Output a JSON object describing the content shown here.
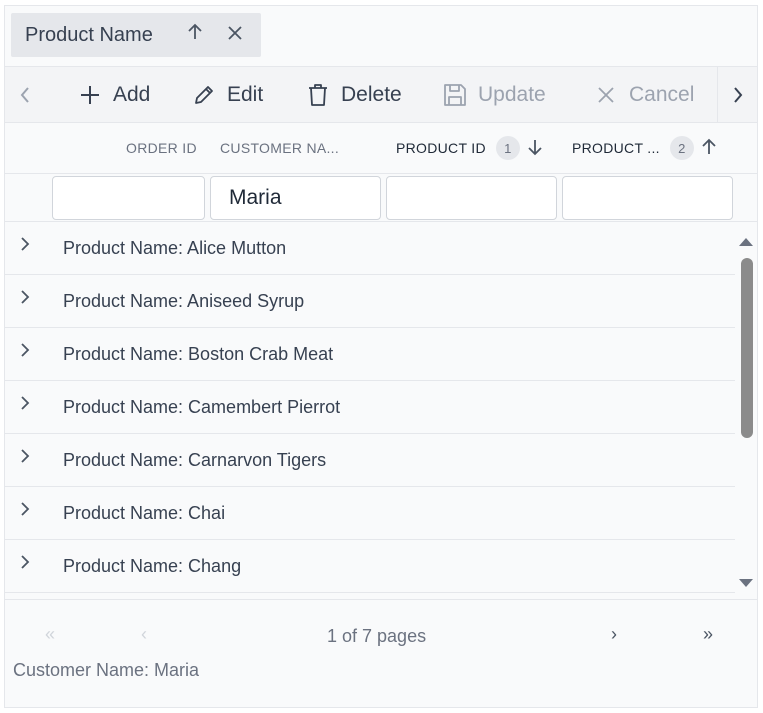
{
  "grouping": {
    "chip_label": "Product Name"
  },
  "toolbar": {
    "add": "Add",
    "edit": "Edit",
    "delete": "Delete",
    "update": "Update",
    "cancel": "Cancel"
  },
  "columns": {
    "order_id": "ORDER ID",
    "customer_name": "CUSTOMER NA...",
    "product_id": "PRODUCT ID",
    "product_id_sort_index": "1",
    "product_name": "PRODUCT ...",
    "product_name_sort_index": "2"
  },
  "filters": {
    "order_id": "",
    "customer_name": "Maria",
    "product_id": "",
    "product_name": ""
  },
  "groups": [
    "Product Name: Alice Mutton",
    "Product Name: Aniseed Syrup",
    "Product Name: Boston Crab Meat",
    "Product Name: Camembert Pierrot",
    "Product Name: Carnarvon Tigers",
    "Product Name: Chai",
    "Product Name: Chang"
  ],
  "pager": {
    "first": "«",
    "prev": "‹",
    "next": "›",
    "last": "»",
    "info": "1 of 7 pages"
  },
  "aggregate": "Customer Name: Maria",
  "icons": {
    "sort_up": "arrow-up-icon",
    "sort_down": "arrow-down-icon",
    "remove": "close-icon",
    "expand": "chevron-right-icon"
  }
}
